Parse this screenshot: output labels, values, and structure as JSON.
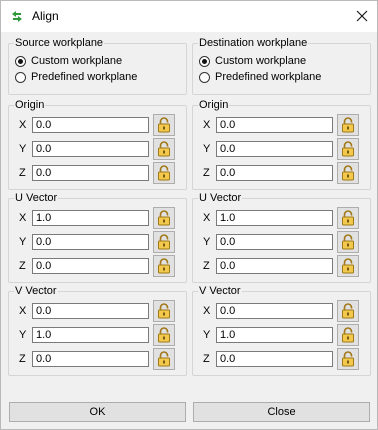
{
  "window": {
    "title": "Align",
    "app_icon": "align-app-icon",
    "close_icon": "close-icon"
  },
  "source_workplane": {
    "label": "Source workplane",
    "options": [
      {
        "label": "Custom workplane",
        "selected": true
      },
      {
        "label": "Predefined workplane",
        "selected": false
      }
    ]
  },
  "destination_workplane": {
    "label": "Destination workplane",
    "options": [
      {
        "label": "Custom workplane",
        "selected": true
      },
      {
        "label": "Predefined workplane",
        "selected": false
      }
    ]
  },
  "axes": [
    "X",
    "Y",
    "Z"
  ],
  "source": {
    "origin": {
      "label": "Origin",
      "values": [
        "0.0",
        "0.0",
        "0.0"
      ]
    },
    "u_vector": {
      "label": "U Vector",
      "values": [
        "1.0",
        "0.0",
        "0.0"
      ]
    },
    "v_vector": {
      "label": "V Vector",
      "values": [
        "0.0",
        "1.0",
        "0.0"
      ]
    }
  },
  "destination": {
    "origin": {
      "label": "Origin",
      "values": [
        "0.0",
        "0.0",
        "0.0"
      ]
    },
    "u_vector": {
      "label": "U Vector",
      "values": [
        "1.0",
        "0.0",
        "0.0"
      ]
    },
    "v_vector": {
      "label": "V Vector",
      "values": [
        "0.0",
        "1.0",
        "0.0"
      ]
    }
  },
  "lock_icon": "lock-icon",
  "buttons": {
    "ok": "OK",
    "close": "Close"
  }
}
